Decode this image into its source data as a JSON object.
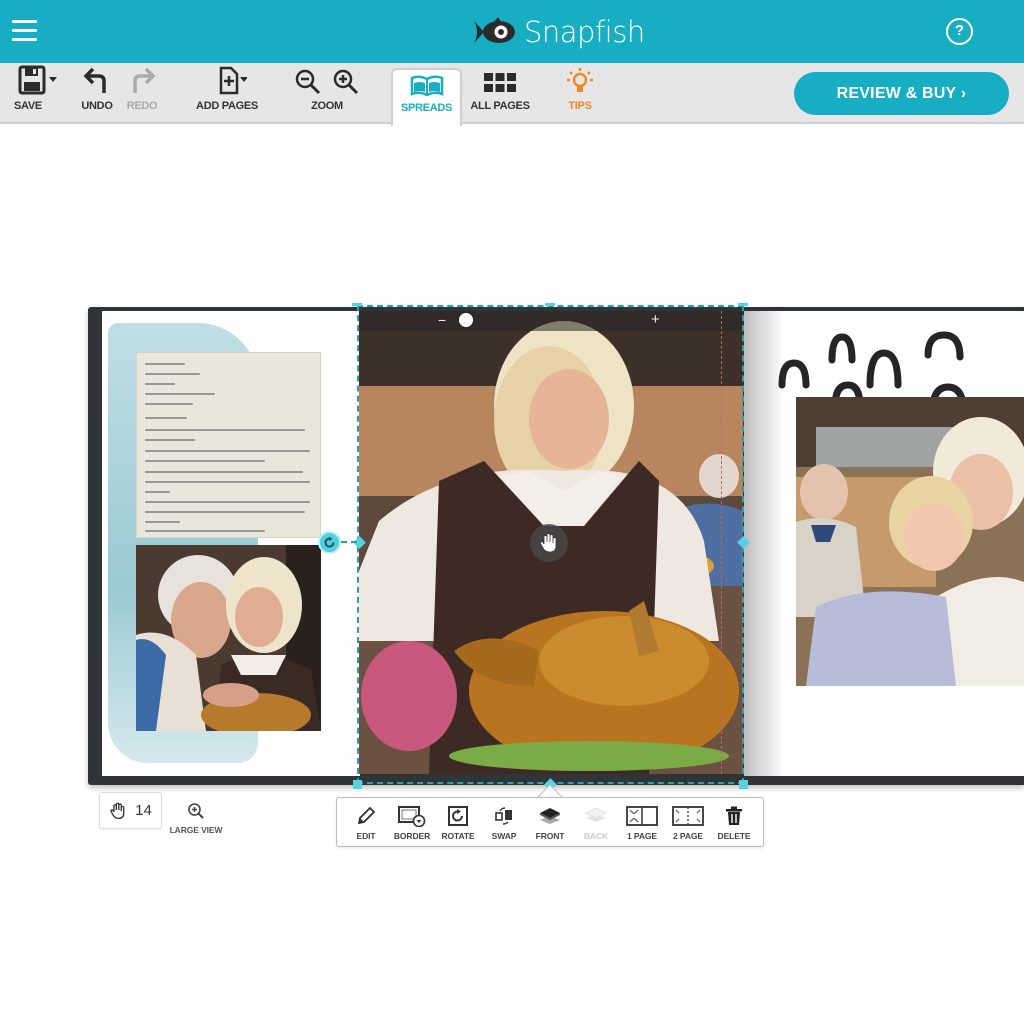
{
  "header": {
    "brand": "Snapfish",
    "menu_icon": "hamburger-icon",
    "help_icon": "help-icon",
    "help_glyph": "?",
    "colors": {
      "brand": "#17adc2",
      "tips": "#f08a24",
      "selection": "#21a3b6"
    }
  },
  "toolbar": {
    "save_label": "SAVE",
    "undo_label": "UNDO",
    "redo_label": "REDO",
    "add_pages_label": "ADD PAGES",
    "zoom_label": "ZOOM",
    "spreads_label": "SPREADS",
    "all_pages_label": "ALL PAGES",
    "tips_label": "TIPS",
    "review_buy_label": "REVIEW & BUY ›",
    "active_tab": "SPREADS",
    "redo_enabled": false
  },
  "editor": {
    "selected_photo": "turkey-woman-photo",
    "zoom_slider": {
      "minus": "−",
      "plus": "+",
      "value_fraction": 0.06
    },
    "page_count": "14",
    "large_view_label": "LARGE VIEW"
  },
  "context_menu": {
    "items": [
      {
        "label": "EDIT",
        "icon": "pencil-icon",
        "enabled": true
      },
      {
        "label": "BORDER",
        "icon": "border-icon",
        "enabled": true
      },
      {
        "label": "ROTATE",
        "icon": "rotate-icon",
        "enabled": true
      },
      {
        "label": "SWAP",
        "icon": "swap-icon",
        "enabled": true
      },
      {
        "label": "FRONT",
        "icon": "bring-front-icon",
        "enabled": true
      },
      {
        "label": "BACK",
        "icon": "send-back-icon",
        "enabled": false
      },
      {
        "label": "1 PAGE",
        "icon": "one-page-icon",
        "enabled": true
      },
      {
        "label": "2 PAGE",
        "icon": "two-page-icon",
        "enabled": true
      },
      {
        "label": "DELETE",
        "icon": "trash-icon",
        "enabled": true
      }
    ]
  }
}
